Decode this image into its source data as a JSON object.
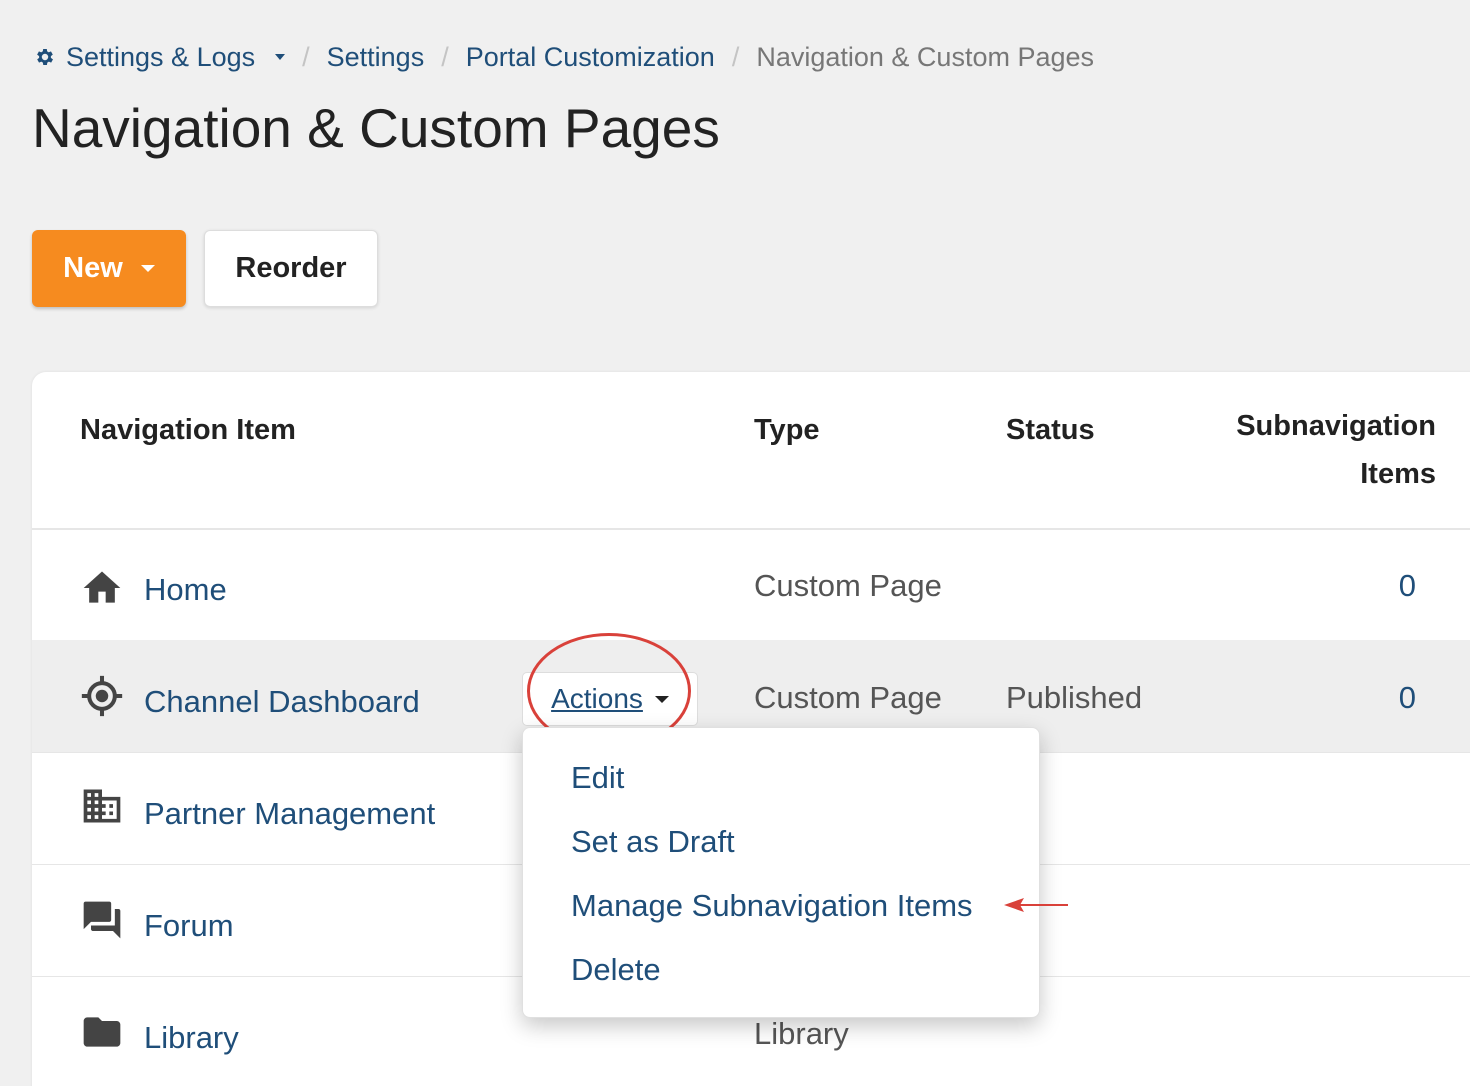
{
  "breadcrumb": {
    "root": "Settings & Logs",
    "items": [
      "Settings",
      "Portal Customization"
    ],
    "current": "Navigation & Custom Pages"
  },
  "page": {
    "title": "Navigation & Custom Pages"
  },
  "toolbar": {
    "new_label": "New",
    "reorder_label": "Reorder"
  },
  "table": {
    "headers": {
      "item": "Navigation Item",
      "type": "Type",
      "status": "Status",
      "sub_line1": "Subnavigation",
      "sub_line2": "Items"
    },
    "rows": [
      {
        "label": "Home",
        "icon": "home-icon",
        "type": "Custom Page",
        "status": "",
        "subitems": "0"
      },
      {
        "label": "Channel Dashboard",
        "icon": "target-icon",
        "type": "Custom Page",
        "status": "Published",
        "subitems": "0"
      },
      {
        "label": "Partner Management",
        "icon": "building-icon",
        "type": "",
        "status": "",
        "subitems": ""
      },
      {
        "label": "Forum",
        "icon": "forum-icon",
        "type": "",
        "status": "",
        "subitems": ""
      },
      {
        "label": "Library",
        "icon": "folder-icon",
        "type": "Library",
        "status": "",
        "subitems": ""
      }
    ]
  },
  "actions": {
    "label": "Actions",
    "menu": [
      "Edit",
      "Set as Draft",
      "Manage Subnavigation Items",
      "Delete"
    ]
  },
  "colors": {
    "primary_orange": "#f68b1f",
    "link_blue": "#1f4e79",
    "annotation_red": "#d9413a",
    "background": "#f0f0f0"
  }
}
